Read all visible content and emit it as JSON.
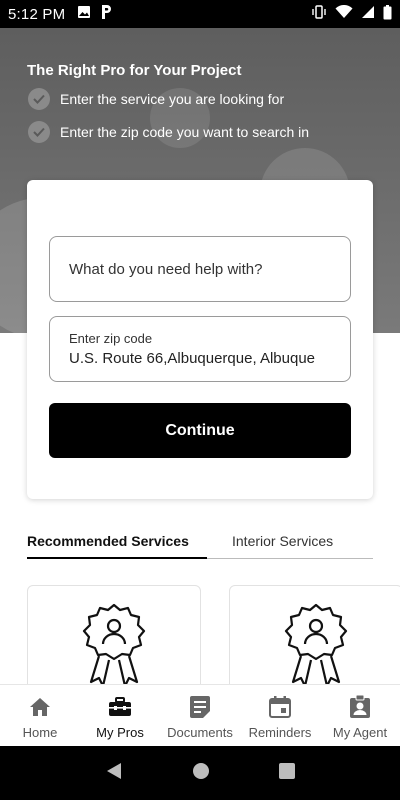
{
  "status_bar": {
    "time": "5:12 PM",
    "left_icons": [
      "image-icon",
      "parking-icon"
    ],
    "right_icons": [
      "vibrate-icon",
      "wifi-icon",
      "signal-icon",
      "battery-icon"
    ]
  },
  "hero": {
    "title": "The Right Pro for Your Project",
    "steps": [
      "Enter the service you are looking for",
      "Enter the zip code you want to search in"
    ]
  },
  "search": {
    "service_placeholder": "What do you need help with?",
    "zip_label": "Enter zip code",
    "zip_value": "U.S. Route 66,Albuquerque, Albuque",
    "continue_label": "Continue"
  },
  "tabs": [
    {
      "label": "Recommended Services",
      "active": true
    },
    {
      "label": "Interior Services",
      "active": false
    }
  ],
  "bottom_nav": [
    {
      "label": "Home",
      "icon": "home-icon"
    },
    {
      "label": "My Pros",
      "icon": "toolbox-icon",
      "active": true
    },
    {
      "label": "Documents",
      "icon": "document-icon"
    },
    {
      "label": "Reminders",
      "icon": "calendar-icon"
    },
    {
      "label": "My Agent",
      "icon": "agent-badge-icon"
    }
  ],
  "colors": {
    "primary": "#000000",
    "hero_overlay": "#666666",
    "text": "#111111"
  }
}
